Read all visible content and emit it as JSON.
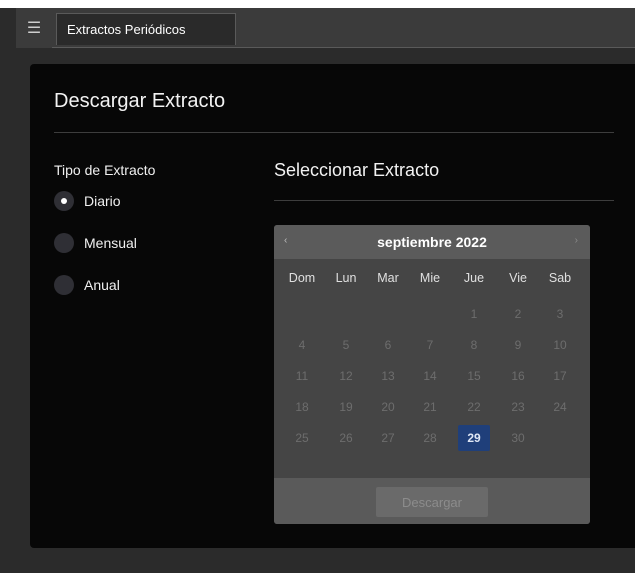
{
  "tabbar": {
    "tab_label": "Extractos Periódicos"
  },
  "panel": {
    "title": "Descargar Extracto",
    "tipo_label": "Tipo de Extracto",
    "options": [
      {
        "label": "Diario",
        "selected": true
      },
      {
        "label": "Mensual",
        "selected": false
      },
      {
        "label": "Anual",
        "selected": false
      }
    ],
    "select_label": "Seleccionar Extracto"
  },
  "calendar": {
    "month_label": "septiembre 2022",
    "prev_label": "‹",
    "next_label": "›",
    "weekdays": [
      "Dom",
      "Lun",
      "Mar",
      "Mie",
      "Jue",
      "Vie",
      "Sab"
    ],
    "weeks": [
      [
        "",
        "",
        "",
        "",
        "1",
        "2",
        "3"
      ],
      [
        "4",
        "5",
        "6",
        "7",
        "8",
        "9",
        "10"
      ],
      [
        "11",
        "12",
        "13",
        "14",
        "15",
        "16",
        "17"
      ],
      [
        "18",
        "19",
        "20",
        "21",
        "22",
        "23",
        "24"
      ],
      [
        "25",
        "26",
        "27",
        "28",
        "29",
        "30",
        ""
      ]
    ],
    "selected_day": "29",
    "download_label": "Descargar"
  },
  "colors": {
    "selected_day": "#1f3f7a",
    "panel_bg": "#070707"
  },
  "icons": {
    "menu": "hamburger-icon"
  }
}
